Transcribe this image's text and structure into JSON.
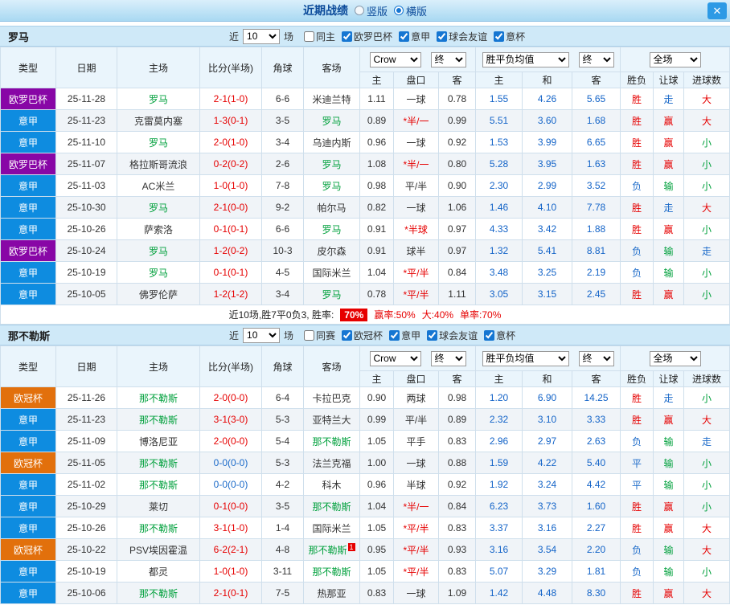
{
  "titlebar": {
    "title": "近期战绩",
    "radios": [
      {
        "label": "竖版",
        "checked": false
      },
      {
        "label": "横版",
        "checked": true
      }
    ],
    "close": "✕"
  },
  "filters_shared": {
    "near": "近",
    "games": "场"
  },
  "table_header": {
    "type": "类型",
    "date": "日期",
    "home": "主场",
    "score": "比分(半场)",
    "corners": "角球",
    "away": "客场",
    "bookmaker": "Crow",
    "final": "终",
    "odds_home": "主",
    "handicap": "盘口",
    "odds_away": "客",
    "euro_label": "胜平负均值",
    "euro_home": "主",
    "euro_draw": "和",
    "euro_away": "客",
    "fullmatch": "全场",
    "wdl": "胜负",
    "handicap_result": "让球",
    "goals": "进球数"
  },
  "sections": [
    {
      "team": "罗马",
      "filters": {
        "count": "10",
        "checkboxes": [
          {
            "label": "同主",
            "checked": false
          },
          {
            "label": "欧罗巴杯",
            "checked": true
          },
          {
            "label": "意甲",
            "checked": true
          },
          {
            "label": "球会友谊",
            "checked": true
          },
          {
            "label": "意杯",
            "checked": true
          }
        ]
      },
      "rows": [
        {
          "league": "欧罗巴杯",
          "league_color": "purple",
          "date": "25-11-28",
          "home": "罗马",
          "home_focus": true,
          "score": "2-1(1-0)",
          "score_color": "red",
          "corners": "6-6",
          "away": "米迪兰特",
          "away_focus": false,
          "asian": {
            "home": "1.11",
            "line": "一球",
            "red": false,
            "away": "0.78"
          },
          "euro": {
            "home": "1.55",
            "draw": "4.26",
            "away": "5.65"
          },
          "results": [
            {
              "text": "胜",
              "color": "red"
            },
            {
              "text": "走",
              "color": "blue"
            },
            {
              "text": "大",
              "color": "red"
            }
          ]
        },
        {
          "league": "意甲",
          "league_color": "blue",
          "date": "25-11-23",
          "home": "克雷莫内塞",
          "home_focus": false,
          "score": "1-3(0-1)",
          "score_color": "red",
          "corners": "3-5",
          "away": "罗马",
          "away_focus": true,
          "asian": {
            "home": "0.89",
            "line": "*半/一",
            "red": true,
            "away": "0.99"
          },
          "euro": {
            "home": "5.51",
            "draw": "3.60",
            "away": "1.68"
          },
          "results": [
            {
              "text": "胜",
              "color": "red"
            },
            {
              "text": "赢",
              "color": "red"
            },
            {
              "text": "大",
              "color": "red"
            }
          ]
        },
        {
          "league": "意甲",
          "league_color": "blue",
          "date": "25-11-10",
          "home": "罗马",
          "home_focus": true,
          "score": "2-0(1-0)",
          "score_color": "red",
          "corners": "3-4",
          "away": "乌迪内斯",
          "away_focus": false,
          "asian": {
            "home": "0.96",
            "line": "一球",
            "red": false,
            "away": "0.92"
          },
          "euro": {
            "home": "1.53",
            "draw": "3.99",
            "away": "6.65"
          },
          "results": [
            {
              "text": "胜",
              "color": "red"
            },
            {
              "text": "赢",
              "color": "red"
            },
            {
              "text": "小",
              "color": "green"
            }
          ]
        },
        {
          "league": "欧罗巴杯",
          "league_color": "purple",
          "date": "25-11-07",
          "home": "格拉斯哥流浪",
          "home_focus": false,
          "score": "0-2(0-2)",
          "score_color": "red",
          "corners": "2-6",
          "away": "罗马",
          "away_focus": true,
          "asian": {
            "home": "1.08",
            "line": "*半/一",
            "red": true,
            "away": "0.80"
          },
          "euro": {
            "home": "5.28",
            "draw": "3.95",
            "away": "1.63"
          },
          "results": [
            {
              "text": "胜",
              "color": "red"
            },
            {
              "text": "赢",
              "color": "red"
            },
            {
              "text": "小",
              "color": "green"
            }
          ]
        },
        {
          "league": "意甲",
          "league_color": "blue",
          "date": "25-11-03",
          "home": "AC米兰",
          "home_focus": false,
          "score": "1-0(1-0)",
          "score_color": "red",
          "corners": "7-8",
          "away": "罗马",
          "away_focus": true,
          "asian": {
            "home": "0.98",
            "line": "平/半",
            "red": false,
            "away": "0.90"
          },
          "euro": {
            "home": "2.30",
            "draw": "2.99",
            "away": "3.52"
          },
          "results": [
            {
              "text": "负",
              "color": "blue"
            },
            {
              "text": "输",
              "color": "green"
            },
            {
              "text": "小",
              "color": "green"
            }
          ]
        },
        {
          "league": "意甲",
          "league_color": "blue",
          "date": "25-10-30",
          "home": "罗马",
          "home_focus": true,
          "score": "2-1(0-0)",
          "score_color": "red",
          "corners": "9-2",
          "away": "帕尔马",
          "away_focus": false,
          "asian": {
            "home": "0.82",
            "line": "一球",
            "red": false,
            "away": "1.06"
          },
          "euro": {
            "home": "1.46",
            "draw": "4.10",
            "away": "7.78"
          },
          "results": [
            {
              "text": "胜",
              "color": "red"
            },
            {
              "text": "走",
              "color": "blue"
            },
            {
              "text": "大",
              "color": "red"
            }
          ]
        },
        {
          "league": "意甲",
          "league_color": "blue",
          "date": "25-10-26",
          "home": "萨索洛",
          "home_focus": false,
          "score": "0-1(0-1)",
          "score_color": "red",
          "corners": "6-6",
          "away": "罗马",
          "away_focus": true,
          "asian": {
            "home": "0.91",
            "line": "*半球",
            "red": true,
            "away": "0.97"
          },
          "euro": {
            "home": "4.33",
            "draw": "3.42",
            "away": "1.88"
          },
          "results": [
            {
              "text": "胜",
              "color": "red"
            },
            {
              "text": "赢",
              "color": "red"
            },
            {
              "text": "小",
              "color": "green"
            }
          ]
        },
        {
          "league": "欧罗巴杯",
          "league_color": "purple",
          "date": "25-10-24",
          "home": "罗马",
          "home_focus": true,
          "score": "1-2(0-2)",
          "score_color": "red",
          "corners": "10-3",
          "away": "皮尔森",
          "away_focus": false,
          "asian": {
            "home": "0.91",
            "line": "球半",
            "red": false,
            "away": "0.97"
          },
          "euro": {
            "home": "1.32",
            "draw": "5.41",
            "away": "8.81"
          },
          "results": [
            {
              "text": "负",
              "color": "blue"
            },
            {
              "text": "输",
              "color": "green"
            },
            {
              "text": "走",
              "color": "blue"
            }
          ]
        },
        {
          "league": "意甲",
          "league_color": "blue",
          "date": "25-10-19",
          "home": "罗马",
          "home_focus": true,
          "score": "0-1(0-1)",
          "score_color": "red",
          "corners": "4-5",
          "away": "国际米兰",
          "away_focus": false,
          "asian": {
            "home": "1.04",
            "line": "*平/半",
            "red": true,
            "away": "0.84"
          },
          "euro": {
            "home": "3.48",
            "draw": "3.25",
            "away": "2.19"
          },
          "results": [
            {
              "text": "负",
              "color": "blue"
            },
            {
              "text": "输",
              "color": "green"
            },
            {
              "text": "小",
              "color": "green"
            }
          ]
        },
        {
          "league": "意甲",
          "league_color": "blue",
          "date": "25-10-05",
          "home": "佛罗伦萨",
          "home_focus": false,
          "score": "1-2(1-2)",
          "score_color": "red",
          "corners": "3-4",
          "away": "罗马",
          "away_focus": true,
          "asian": {
            "home": "0.78",
            "line": "*平/半",
            "red": true,
            "away": "1.11"
          },
          "euro": {
            "home": "3.05",
            "draw": "3.15",
            "away": "2.45"
          },
          "results": [
            {
              "text": "胜",
              "color": "red"
            },
            {
              "text": "赢",
              "color": "red"
            },
            {
              "text": "小",
              "color": "green"
            }
          ]
        }
      ],
      "summary": {
        "prefix": "近10场,胜7平0负3, 胜率:",
        "win_rate": "70%",
        "profit_rate": "赢率:50%",
        "big_rate": "大:40%",
        "single_rate": "单率:70%"
      }
    },
    {
      "team": "那不勒斯",
      "filters": {
        "count": "10",
        "checkboxes": [
          {
            "label": "同赛",
            "checked": false
          },
          {
            "label": "欧冠杯",
            "checked": true
          },
          {
            "label": "意甲",
            "checked": true
          },
          {
            "label": "球会友谊",
            "checked": true
          },
          {
            "label": "意杯",
            "checked": true
          }
        ]
      },
      "rows": [
        {
          "league": "欧冠杯",
          "league_color": "orange",
          "date": "25-11-26",
          "home": "那不勒斯",
          "home_focus": true,
          "score": "2-0(0-0)",
          "score_color": "red",
          "corners": "6-4",
          "away": "卡拉巴克",
          "away_focus": false,
          "asian": {
            "home": "0.90",
            "line": "两球",
            "red": false,
            "away": "0.98"
          },
          "euro": {
            "home": "1.20",
            "draw": "6.90",
            "away": "14.25"
          },
          "results": [
            {
              "text": "胜",
              "color": "red"
            },
            {
              "text": "走",
              "color": "blue"
            },
            {
              "text": "小",
              "color": "green"
            }
          ]
        },
        {
          "league": "意甲",
          "league_color": "blue",
          "date": "25-11-23",
          "home": "那不勒斯",
          "home_focus": true,
          "score": "3-1(3-0)",
          "score_color": "red",
          "corners": "5-3",
          "away": "亚特兰大",
          "away_focus": false,
          "asian": {
            "home": "0.99",
            "line": "平/半",
            "red": false,
            "away": "0.89"
          },
          "euro": {
            "home": "2.32",
            "draw": "3.10",
            "away": "3.33"
          },
          "results": [
            {
              "text": "胜",
              "color": "red"
            },
            {
              "text": "赢",
              "color": "red"
            },
            {
              "text": "大",
              "color": "red"
            }
          ]
        },
        {
          "league": "意甲",
          "league_color": "blue",
          "date": "25-11-09",
          "home": "博洛尼亚",
          "home_focus": false,
          "score": "2-0(0-0)",
          "score_color": "red",
          "corners": "5-4",
          "away": "那不勒斯",
          "away_focus": true,
          "asian": {
            "home": "1.05",
            "line": "平手",
            "red": false,
            "away": "0.83"
          },
          "euro": {
            "home": "2.96",
            "draw": "2.97",
            "away": "2.63"
          },
          "results": [
            {
              "text": "负",
              "color": "blue"
            },
            {
              "text": "输",
              "color": "green"
            },
            {
              "text": "走",
              "color": "blue"
            }
          ]
        },
        {
          "league": "欧冠杯",
          "league_color": "orange",
          "date": "25-11-05",
          "home": "那不勒斯",
          "home_focus": true,
          "score": "0-0(0-0)",
          "score_color": "blue",
          "corners": "5-3",
          "away": "法兰克福",
          "away_focus": false,
          "asian": {
            "home": "1.00",
            "line": "一球",
            "red": false,
            "away": "0.88"
          },
          "euro": {
            "home": "1.59",
            "draw": "4.22",
            "away": "5.40"
          },
          "results": [
            {
              "text": "平",
              "color": "blue"
            },
            {
              "text": "输",
              "color": "green"
            },
            {
              "text": "小",
              "color": "green"
            }
          ]
        },
        {
          "league": "意甲",
          "league_color": "blue",
          "date": "25-11-02",
          "home": "那不勒斯",
          "home_focus": true,
          "score": "0-0(0-0)",
          "score_color": "blue",
          "corners": "4-2",
          "away": "科木",
          "away_focus": false,
          "asian": {
            "home": "0.96",
            "line": "半球",
            "red": false,
            "away": "0.92"
          },
          "euro": {
            "home": "1.92",
            "draw": "3.24",
            "away": "4.42"
          },
          "results": [
            {
              "text": "平",
              "color": "blue"
            },
            {
              "text": "输",
              "color": "green"
            },
            {
              "text": "小",
              "color": "green"
            }
          ]
        },
        {
          "league": "意甲",
          "league_color": "blue",
          "date": "25-10-29",
          "home": "莱切",
          "home_focus": false,
          "score": "0-1(0-0)",
          "score_color": "red",
          "corners": "3-5",
          "away": "那不勒斯",
          "away_focus": true,
          "asian": {
            "home": "1.04",
            "line": "*半/一",
            "red": true,
            "away": "0.84"
          },
          "euro": {
            "home": "6.23",
            "draw": "3.73",
            "away": "1.60"
          },
          "results": [
            {
              "text": "胜",
              "color": "red"
            },
            {
              "text": "赢",
              "color": "red"
            },
            {
              "text": "小",
              "color": "green"
            }
          ]
        },
        {
          "league": "意甲",
          "league_color": "blue",
          "date": "25-10-26",
          "home": "那不勒斯",
          "home_focus": true,
          "score": "3-1(1-0)",
          "score_color": "red",
          "corners": "1-4",
          "away": "国际米兰",
          "away_focus": false,
          "asian": {
            "home": "1.05",
            "line": "*平/半",
            "red": true,
            "away": "0.83"
          },
          "euro": {
            "home": "3.37",
            "draw": "3.16",
            "away": "2.27"
          },
          "results": [
            {
              "text": "胜",
              "color": "red"
            },
            {
              "text": "赢",
              "color": "red"
            },
            {
              "text": "大",
              "color": "red"
            }
          ]
        },
        {
          "league": "欧冠杯",
          "league_color": "orange",
          "date": "25-10-22",
          "home": "PSV埃因霍温",
          "home_focus": false,
          "score": "6-2(2-1)",
          "score_color": "red",
          "corners": "4-8",
          "away": "那不勒斯",
          "away_focus": true,
          "away_badge": "1",
          "asian": {
            "home": "0.95",
            "line": "*平/半",
            "red": true,
            "away": "0.93"
          },
          "euro": {
            "home": "3.16",
            "draw": "3.54",
            "away": "2.20"
          },
          "results": [
            {
              "text": "负",
              "color": "blue"
            },
            {
              "text": "输",
              "color": "green"
            },
            {
              "text": "大",
              "color": "red"
            }
          ]
        },
        {
          "league": "意甲",
          "league_color": "blue",
          "date": "25-10-19",
          "home": "都灵",
          "home_focus": false,
          "score": "1-0(1-0)",
          "score_color": "red",
          "corners": "3-11",
          "away": "那不勒斯",
          "away_focus": true,
          "asian": {
            "home": "1.05",
            "line": "*平/半",
            "red": true,
            "away": "0.83"
          },
          "euro": {
            "home": "5.07",
            "draw": "3.29",
            "away": "1.81"
          },
          "results": [
            {
              "text": "负",
              "color": "blue"
            },
            {
              "text": "输",
              "color": "green"
            },
            {
              "text": "小",
              "color": "green"
            }
          ]
        },
        {
          "league": "意甲",
          "league_color": "blue",
          "date": "25-10-06",
          "home": "那不勒斯",
          "home_focus": true,
          "score": "2-1(0-1)",
          "score_color": "red",
          "corners": "7-5",
          "away": "热那亚",
          "away_focus": false,
          "asian": {
            "home": "0.83",
            "line": "一球",
            "red": false,
            "away": "1.09"
          },
          "euro": {
            "home": "1.42",
            "draw": "4.48",
            "away": "8.30"
          },
          "results": [
            {
              "text": "胜",
              "color": "red"
            },
            {
              "text": "赢",
              "color": "red"
            },
            {
              "text": "大",
              "color": "red"
            }
          ]
        }
      ]
    }
  ]
}
